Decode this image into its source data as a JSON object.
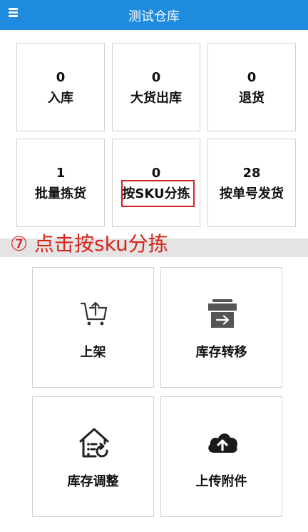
{
  "header": {
    "title": "测试仓库",
    "menu_icon": "hamburger-menu-icon",
    "background_color": "#1e8bde"
  },
  "stats": [
    {
      "count": "0",
      "label": "入库"
    },
    {
      "count": "0",
      "label": "大货出库"
    },
    {
      "count": "0",
      "label": "退货"
    },
    {
      "count": "1",
      "label": "批量拣货"
    },
    {
      "count": "0",
      "label": "按SKU分拣"
    },
    {
      "count": "28",
      "label": "按单号发货"
    }
  ],
  "annotation": {
    "text": "⑦ 点击按sku分拣",
    "color": "#d8241c",
    "highlight_color": "#d62020"
  },
  "functions": [
    {
      "label": "上架",
      "icon": "shopping-cart-icon"
    },
    {
      "label": "库存转移",
      "icon": "store-transfer-icon"
    },
    {
      "label": "库存调整",
      "icon": "house-adjust-icon"
    },
    {
      "label": "上传附件",
      "icon": "cloud-upload-icon"
    }
  ]
}
